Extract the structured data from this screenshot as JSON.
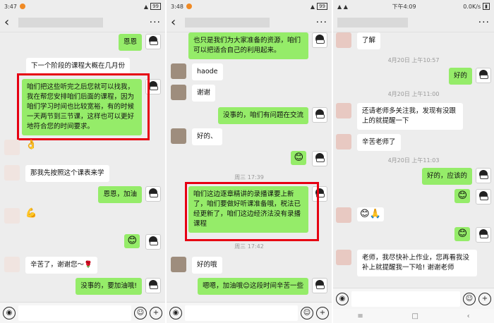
{
  "panel1": {
    "status": {
      "time": "3:47",
      "battery": "99"
    },
    "messages": [
      {
        "text": "恩恩"
      },
      {
        "text": "下一个阶段的课程大概在几月份"
      },
      {
        "text": "咱们把这些听完之后您就可以找我，我在帮您安排咱们后面的课程，因为咱们学习时间也比较宽裕，有的时候一天两节到三节课，这样也可以更好地符合您的时间要求。"
      },
      {
        "text": "👌"
      },
      {
        "text": "那我先按照这个课表来学"
      },
      {
        "text": "恩恩，加油"
      },
      {
        "text": "💪"
      },
      {
        "text": "😊"
      },
      {
        "text": "辛苦了，谢谢您～🌹"
      },
      {
        "text": "没事的，要加油哦!"
      }
    ]
  },
  "panel2": {
    "status": {
      "time": "3:48",
      "battery": "99"
    },
    "messages": [
      {
        "text": "也只是我们为大家准备的资源，咱们可以把适合自己的利用起来。"
      },
      {
        "text": "haode"
      },
      {
        "text": "谢谢"
      },
      {
        "text": "没事的，咱们有问题在交流"
      },
      {
        "text": "好的、"
      },
      {
        "text": "😊"
      },
      {
        "text": "咱们这边逐章精讲的录播课要上新了，咱们要做好听课准备哦，税法已经更新了，咱们这边经济法没有录播课程"
      },
      {
        "text": "好的哦"
      },
      {
        "text": "嗯嗯，加油哦😊这段时间辛苦一些"
      }
    ],
    "timestamps": [
      "周三 17:39",
      "周三 17:42"
    ]
  },
  "panel3": {
    "status": {
      "time": "下午4:09",
      "speed": "0.0K/s"
    },
    "messages": [
      {
        "text": "了解"
      },
      {
        "text": "好的"
      },
      {
        "text": "还请老师多关注我，发现有没跟上的就提醒一下"
      },
      {
        "text": "辛苦老师了"
      },
      {
        "text": "好的，应该的"
      },
      {
        "text": "😊"
      },
      {
        "text": "😊🙏"
      },
      {
        "text": "😊"
      },
      {
        "text": "老师，我尽快补上作业，您再看我没补上就提醒我一下哈! 谢谢老师"
      }
    ],
    "timestamps": [
      "4月20日 上午10:57",
      "4月20日 上午11:00",
      "4月20日 上午11:03"
    ]
  },
  "icons": {
    "back": "‹",
    "more": "···",
    "voice": "◉",
    "emoji": "☺",
    "plus": "+",
    "nav": [
      "≡",
      "□",
      "‹"
    ]
  }
}
